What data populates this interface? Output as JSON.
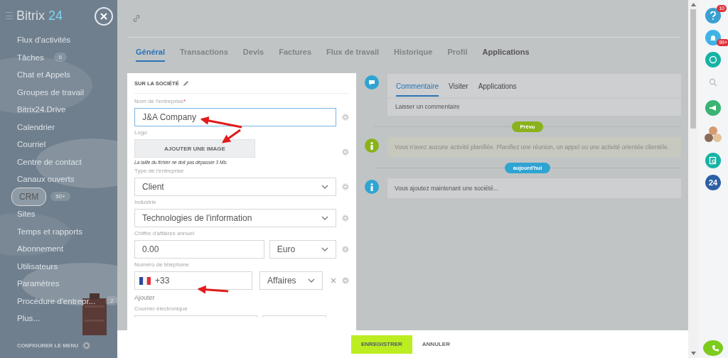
{
  "sidebar": {
    "logo": {
      "name": "Bitrix",
      "number": "24"
    },
    "items": [
      {
        "label": "Flux d'activités",
        "selected": false
      },
      {
        "label": "Tâches",
        "counter": "6",
        "selected": false
      },
      {
        "label": "Chat et Appels",
        "selected": false
      },
      {
        "label": "Groupes de travail",
        "selected": false
      },
      {
        "label": "Bitrix24.Drive",
        "selected": false
      },
      {
        "label": "Calendrier",
        "selected": false
      },
      {
        "label": "Courriel",
        "selected": false
      },
      {
        "label": "Centre de contact",
        "selected": false
      },
      {
        "label": "Canaux ouverts",
        "selected": false
      },
      {
        "label": "CRM",
        "counter": "50+",
        "selected": true
      },
      {
        "label": "Sites",
        "selected": false
      },
      {
        "label": "Temps et rapports",
        "selected": false
      },
      {
        "label": "Abonnement",
        "selected": false
      },
      {
        "label": "Utilisateurs",
        "selected": false
      },
      {
        "label": "Paramètres",
        "selected": false
      },
      {
        "label": "Procédure d'entrepr...",
        "counter": "2",
        "selected": false
      },
      {
        "label": "Plus...",
        "selected": false
      }
    ],
    "configure": "CONFIGURER LE MENU"
  },
  "tabs": [
    {
      "label": "Général",
      "selected": true,
      "disabled": false
    },
    {
      "label": "Transactions",
      "selected": false,
      "disabled": true
    },
    {
      "label": "Devis",
      "selected": false,
      "disabled": true
    },
    {
      "label": "Factures",
      "selected": false,
      "disabled": true
    },
    {
      "label": "Flux de travail",
      "selected": false,
      "disabled": true
    },
    {
      "label": "Historique",
      "selected": false,
      "disabled": true
    },
    {
      "label": "Profil",
      "selected": false,
      "disabled": true
    },
    {
      "label": "Applications",
      "selected": false,
      "disabled": false
    }
  ],
  "form": {
    "section_title": "SUR LA SOCIÉTÉ",
    "fields": [
      {
        "kind": "text",
        "label": "Nom de l'entreprise",
        "required_mark": "*",
        "value": "J&A Company",
        "focused": true
      },
      {
        "label": "Logo",
        "button": "AJOUTER UNE IMAGE",
        "note": "La taille du fichier ne doit pas dépasser 3 Mb."
      },
      {
        "kind": "select",
        "label": "Type de l'entreprise",
        "value": "Client"
      },
      {
        "kind": "select",
        "label": "Industrie",
        "value": "Technologies de l'information"
      },
      {
        "kind": "money",
        "label": "Chiffre d'affaires annuel",
        "value": "0.00",
        "currency": "Euro"
      },
      {
        "kind": "phone",
        "label": "Numéro de téléphone",
        "value": "+33",
        "type": "Affaires"
      },
      {
        "kind": "link",
        "label": "Ajouter"
      },
      {
        "kind": "email",
        "label": "Courrier électronique"
      }
    ]
  },
  "activity": {
    "tabs": [
      {
        "label": "Commentaire",
        "selected": true
      },
      {
        "label": "Visiter",
        "selected": false
      },
      {
        "label": "Applications",
        "selected": false
      }
    ],
    "comment_placeholder": "Laisser un commentaire",
    "groups": [
      {
        "badge": "Prévu",
        "color": "#8ab21c",
        "kind": "planned",
        "text": "Vous n'avez aucune activité planifiée. Planifiez une réunion, un appel ou une activité orientée clientèle."
      },
      {
        "badge": "aujourd'hui",
        "color": "#2fa4d3",
        "kind": "history",
        "text": "Vous ajoutez maintenant une société..."
      }
    ]
  },
  "rail": {
    "help_counter": "10",
    "notifications_counter": "99+",
    "app_label": "24"
  },
  "footer": {
    "save": "ENREGISTRER",
    "cancel": "ANNULER"
  }
}
